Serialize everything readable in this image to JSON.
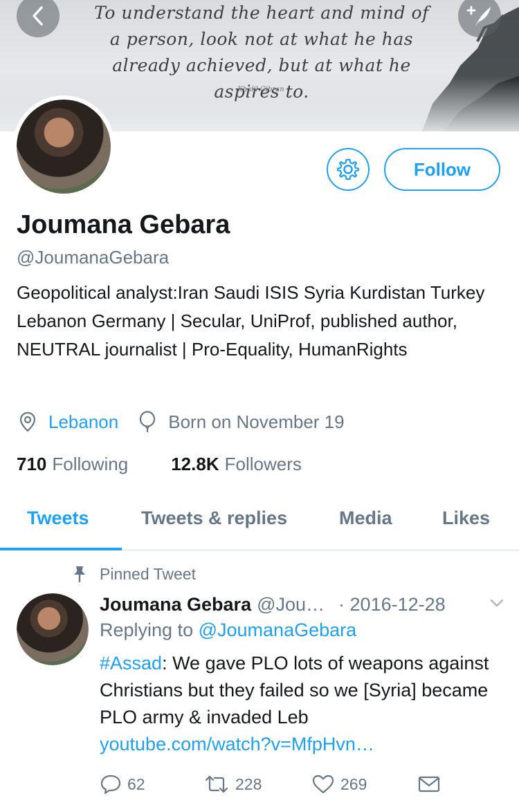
{
  "header": {
    "quote": "To understand the heart and mind of a person, look not at what he has already achieved, but at what he aspires to.",
    "quote_author": "Khalil Gibran",
    "back_icon": "chevron-left-icon",
    "compose_icon": "compose-tweet-icon"
  },
  "profile": {
    "display_name": "Joumana Gebara",
    "handle": "@JoumanaGebara",
    "bio": "Geopolitical analyst:Iran Saudi ISIS Syria Kurdistan Turkey Lebanon Germany | Secular, UniProf, published author, NEUTRAL journalist | Pro-Equality, HumanRights",
    "location": "Lebanon",
    "birthday": "Born on November 19",
    "following_count": "710",
    "following_label": "Following",
    "followers_count": "12.8K",
    "followers_label": "Followers",
    "follow_button": "Follow",
    "settings_icon": "gear-icon"
  },
  "tabs": [
    {
      "label": "Tweets",
      "active": true
    },
    {
      "label": "Tweets & replies",
      "active": false
    },
    {
      "label": "Media",
      "active": false
    },
    {
      "label": "Likes",
      "active": false
    }
  ],
  "tweet": {
    "pinned_label": "Pinned Tweet",
    "author_name": "Joumana Gebara",
    "author_handle": "@Jou…",
    "date": "· 2016-12-28",
    "replying_prefix": "Replying to",
    "replying_handle": "@JoumanaGebara",
    "hashtag": "#Assad",
    "text": ": We gave PLO lots of weapons against Christians but they failed so we [Syria] became PLO army & invaded Leb",
    "link": "youtube.com/watch?v=MfpHvn…",
    "replies": "62",
    "retweets": "228",
    "likes": "269"
  },
  "colors": {
    "accent": "#1da1f2",
    "secondary_text": "#657786",
    "primary_text": "#14171a",
    "divider": "#ccd6dd"
  }
}
